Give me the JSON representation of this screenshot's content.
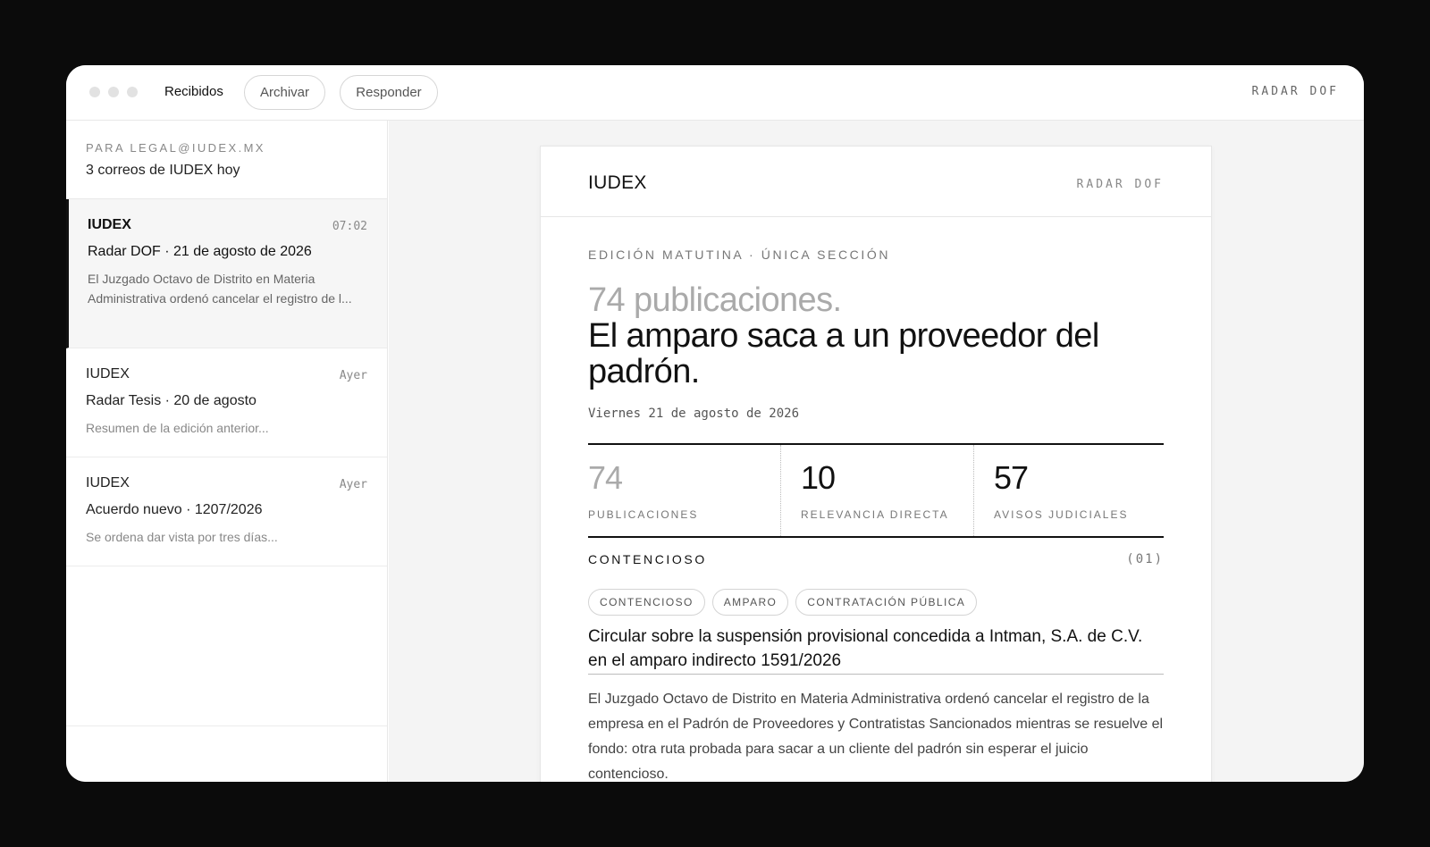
{
  "toolbar": {
    "inbox_label": "Recibidos",
    "archive_label": "Archivar",
    "reply_label": "Responder",
    "brand": "RADAR DOF"
  },
  "sidebar": {
    "to": "PARA LEGAL@IUDEX.MX",
    "count": "3 correos de IUDEX hoy",
    "mails": [
      {
        "from": "IUDEX",
        "time": "07:02",
        "subject": "Radar DOF · 21 de agosto de 2026",
        "preview": "El Juzgado Octavo de Distrito en Materia Administrativa ordenó cancelar el registro de l..."
      },
      {
        "from": "IUDEX",
        "time": "Ayer",
        "subject": "Radar Tesis · 20 de agosto",
        "preview": "Resumen de la edición anterior..."
      },
      {
        "from": "IUDEX",
        "time": "Ayer",
        "subject": "Acuerdo nuevo · 1207/2026",
        "preview": "Se ordena dar vista por tres días..."
      }
    ]
  },
  "letter": {
    "logo": "IUDEX",
    "brand": "RADAR DOF",
    "edition": "EDICIÓN MATUTINA · ÚNICA SECCIÓN",
    "lead": "74 publicaciones.",
    "title": "El amparo saca a un proveedor del padrón.",
    "date": "Viernes 21 de agosto de 2026",
    "stats": [
      {
        "value": "74",
        "label": "PUBLICACIONES"
      },
      {
        "value": "10",
        "label": "RELEVANCIA DIRECTA"
      },
      {
        "value": "57",
        "label": "AVISOS JUDICIALES"
      }
    ],
    "section": {
      "name": "CONTENCIOSO",
      "number": "(01)"
    },
    "tags": [
      "CONTENCIOSO",
      "AMPARO",
      "CONTRATACIÓN PÚBLICA"
    ],
    "article_title": "Circular sobre la suspensión provisional concedida a Intman, S.A. de C.V. en el amparo indirecto 1591/2026",
    "article_body": "El Juzgado Octavo de Distrito en Materia Administrativa ordenó cancelar el registro de la empresa en el Padrón de Proveedores y Contratistas Sancionados mientras se resuelve el fondo: otra ruta probada para sacar a un cliente del padrón sin esperar el juicio contencioso."
  }
}
